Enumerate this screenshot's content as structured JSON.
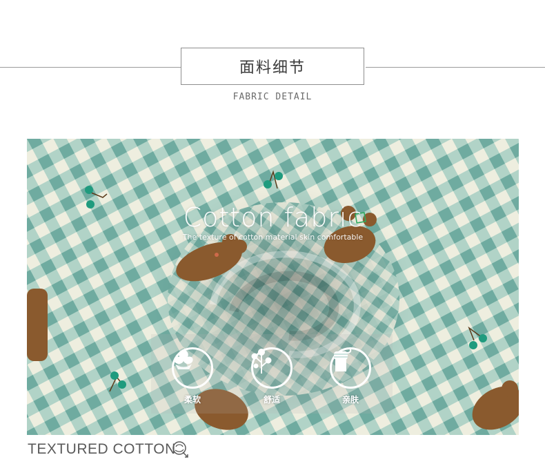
{
  "header": {
    "title": "面料细节",
    "subtitle": "FABRIC DETAIL"
  },
  "photo": {
    "headline": "Cotton fabric",
    "tagline": "The texture of cotton material skin comfortable",
    "features": [
      {
        "icon": "cotton-flower-icon",
        "label": "柔软"
      },
      {
        "icon": "cotton-branch-icon",
        "label": "舒适"
      },
      {
        "icon": "fist-icon",
        "label": "亲肤"
      }
    ]
  },
  "footer": {
    "text": "TEXTURED COTTON",
    "icon": "cotton-boll-icon"
  },
  "colors": {
    "gingham_teal": "#7fb7ad",
    "gingham_base": "#eeeedf",
    "bear_brown": "#8a5a2e",
    "cherry_green": "#1f9b7e"
  }
}
